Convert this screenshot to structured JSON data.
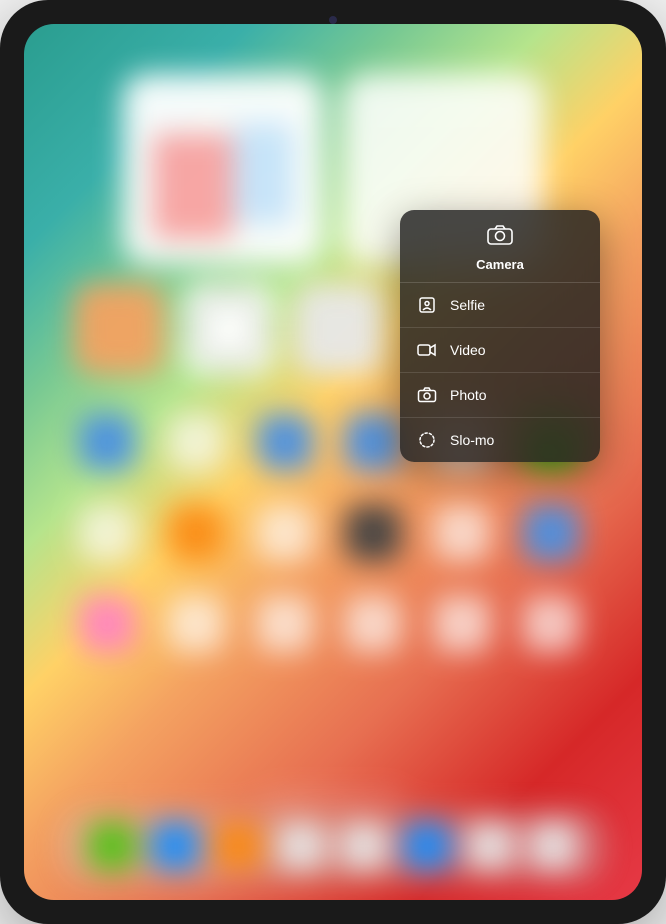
{
  "menu": {
    "title": "Camera",
    "items": [
      {
        "label": "Selfie",
        "icon": "portrait-icon"
      },
      {
        "label": "Video",
        "icon": "video-icon"
      },
      {
        "label": "Photo",
        "icon": "camera-icon"
      },
      {
        "label": "Slo-mo",
        "icon": "slomo-icon"
      }
    ]
  }
}
